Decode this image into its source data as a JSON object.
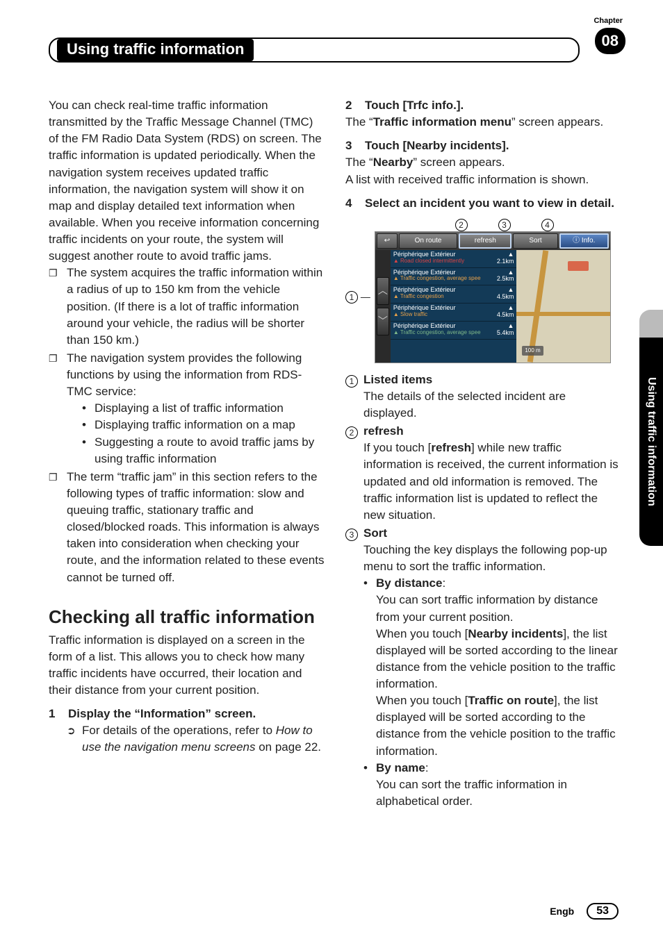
{
  "header": {
    "chapter_label": "Chapter",
    "chapter_num": "08",
    "title": "Using traffic information"
  },
  "side_tab": "Using traffic information",
  "footer": {
    "lang": "Engb",
    "page": "53"
  },
  "left": {
    "intro": "You can check real-time traffic information transmitted by the Traffic Message Channel (TMC) of the FM Radio Data System (RDS) on screen. The traffic information is updated periodically. When the navigation system receives updated traffic information, the navigation system will show it on map and display detailed text information when available. When you receive information concerning traffic incidents on your route, the system will suggest another route to avoid traffic jams.",
    "sq1": "The system acquires the traffic information within a radius of up to 150 km from the vehicle position. (If there is a lot of traffic information around your vehicle, the radius will be shorter than 150 km.)",
    "sq2": "The navigation system provides the following functions by using the information from RDS-TMC service:",
    "sq2_b1": "Displaying a list of traffic information",
    "sq2_b2": "Displaying traffic information on a map",
    "sq2_b3": "Suggesting a route to avoid traffic jams by using traffic information",
    "sq3": "The term “traffic jam” in this section refers to the following types of traffic information: slow and queuing traffic, stationary traffic and closed/blocked roads. This information is always taken into consideration when checking your route, and the information related to these events cannot be turned off.",
    "h2": "Checking all traffic information",
    "h2_intro": "Traffic information is displayed on a screen in the form of a list. This allows you to check how many traffic incidents have occurred, their location and their distance from your current position.",
    "step1_num": "1",
    "step1_title": "Display the “Information” screen.",
    "step1_ref_a": "For details of the operations, refer to ",
    "step1_ref_b": "How to use the navigation menu screens",
    "step1_ref_c": " on page 22."
  },
  "right": {
    "step2_num": "2",
    "step2_title": "Touch [Trfc info.].",
    "step2_body_a": "The “",
    "step2_body_b": "Traffic information menu",
    "step2_body_c": "” screen appears.",
    "step3_num": "3",
    "step3_title": "Touch [Nearby incidents].",
    "step3_body_a": "The “",
    "step3_body_b": "Nearby",
    "step3_body_c": "” screen appears.",
    "step3_body2": "A list with received traffic information is shown.",
    "step4_num": "4",
    "step4_title": "Select an incident you want to view in detail.",
    "callout_2": "2",
    "callout_3": "3",
    "callout_4": "4",
    "callout_1": "1",
    "shot": {
      "btn_back": "↩",
      "btn_onroute": "On route",
      "btn_refresh": "refresh",
      "btn_sort": "Sort",
      "btn_info": "ⓘ Info.",
      "scroll_up": "︿",
      "scroll_down": "﹀",
      "rows": [
        {
          "title": "Périphérique Extérieur",
          "sub": "Road closed intermittently",
          "cls": "red",
          "dist": "2.1km"
        },
        {
          "title": "Périphérique Extérieur",
          "sub": "Traffic congestion, average spee",
          "cls": "orange",
          "dist": "2.5km"
        },
        {
          "title": "Périphérique Extérieur",
          "sub": "Traffic congestion",
          "cls": "orange",
          "dist": "4.5km"
        },
        {
          "title": "Périphérique Extérieur",
          "sub": "Slow traffic",
          "cls": "orange",
          "dist": "4.5km"
        },
        {
          "title": "Périphérique Extérieur",
          "sub": "Traffic congestion, average spee",
          "cls": "green",
          "dist": "5.4km"
        }
      ],
      "map_scale": "100 m"
    },
    "nd1_title": "Listed items",
    "nd1_body": "The details of the selected incident are displayed.",
    "nd2_title": "refresh",
    "nd2_body_a": "If you touch [",
    "nd2_body_b": "refresh",
    "nd2_body_c": "] while new traffic information is received, the current information is updated and old information is removed. The traffic information list is updated to reflect the new situation.",
    "nd3_title": "Sort",
    "nd3_body": "Touching the key displays the following pop-up menu to sort the traffic information.",
    "nd3_s1_title": "By distance",
    "nd3_s1_colon": ":",
    "nd3_s1_body_a": "You can sort traffic information by distance from your current position.",
    "nd3_s1_body_b1": "When you touch [",
    "nd3_s1_body_b2": "Nearby incidents",
    "nd3_s1_body_b3": "], the list displayed will be sorted according to the linear distance from the vehicle position to the traffic information.",
    "nd3_s1_body_c1": "When you touch [",
    "nd3_s1_body_c2": "Traffic on route",
    "nd3_s1_body_c3": "], the list displayed will be sorted according to the distance from the vehicle position to the traffic information.",
    "nd3_s2_title": "By name",
    "nd3_s2_colon": ":",
    "nd3_s2_body": "You can sort the traffic information in alphabetical order."
  }
}
